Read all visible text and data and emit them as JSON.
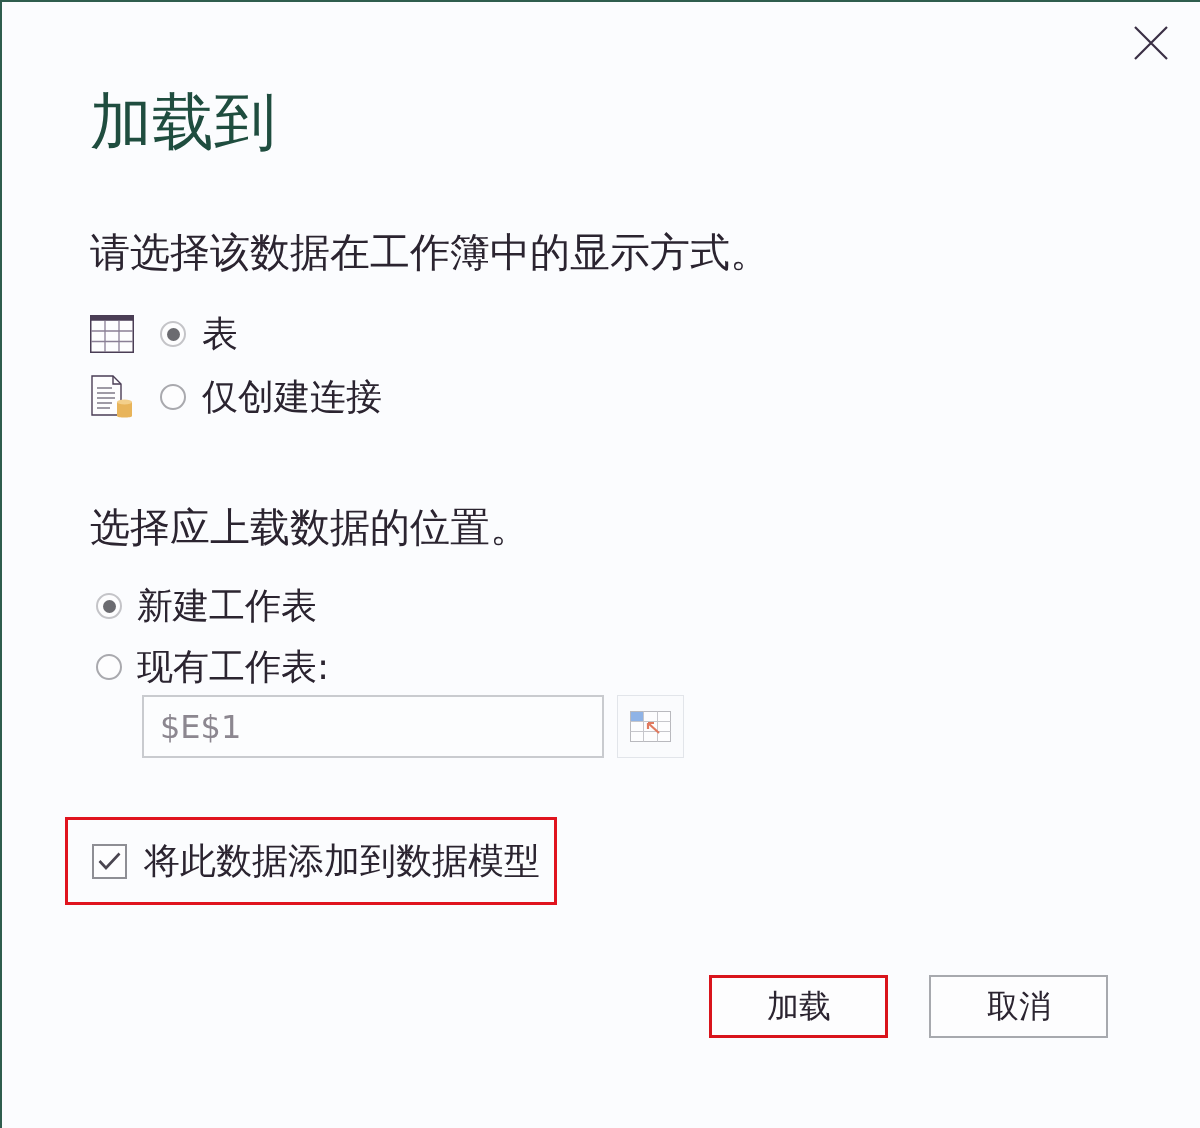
{
  "window": {
    "title": "加载到"
  },
  "display": {
    "prompt": "请选择该数据在工作簿中的显示方式。",
    "options": [
      {
        "label": "表",
        "kind": "table",
        "selected": true
      },
      {
        "label": "仅创建连接",
        "kind": "connection",
        "selected": false
      }
    ]
  },
  "location": {
    "prompt": "选择应上载数据的位置。",
    "options": [
      {
        "label": "新建工作表",
        "selected": true
      },
      {
        "label": "现有工作表:",
        "selected": false
      }
    ],
    "cell_reference": {
      "value": "$E$1",
      "disabled": true
    }
  },
  "data_model": {
    "label": "将此数据添加到数据模型",
    "checked": true,
    "highlighted": true
  },
  "buttons": [
    {
      "label": "加载",
      "highlighted": true
    },
    {
      "label": "取消",
      "highlighted": false
    }
  ]
}
